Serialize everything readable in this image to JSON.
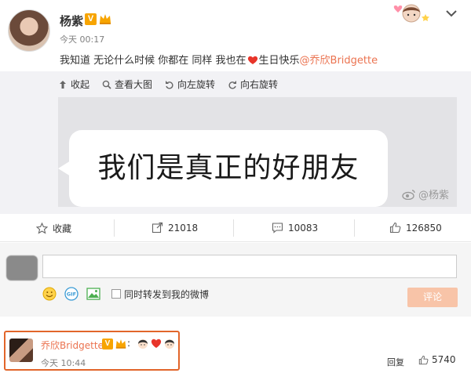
{
  "post": {
    "author": "杨紫",
    "verified_badge": "V",
    "time": "今天 00:17",
    "text_main": "我知道 无论什么时候 你都在 同样 我也在",
    "text_after_heart": "生日快乐",
    "mention": "@乔欣Bridgette"
  },
  "media": {
    "tools": [
      "收起",
      "查看大图",
      "向左旋转",
      "向右旋转"
    ],
    "image_text": "我们是真正的好朋友",
    "watermark": "@杨紫"
  },
  "actions": {
    "favorite": "收藏",
    "repost_count": "21018",
    "comment_count": "10083",
    "like_count": "126850"
  },
  "composer": {
    "sync_repost_label": "同时转发到我的微博",
    "submit_label": "评论"
  },
  "comment": {
    "author": "乔欣Bridgette",
    "verified_badge": "V",
    "colon": ":",
    "time": "今天 10:44",
    "report_label": "回复",
    "like_count": "5740"
  },
  "colors": {
    "accent_orange": "#eb7350",
    "highlight_border": "#e2652a",
    "submit_disabled": "#f8c4a8",
    "verified_gold": "#f7a400"
  },
  "icons": [
    "crown-icon",
    "heart-icon",
    "chevron-down-icon",
    "collapse-icon",
    "zoom-icon",
    "rotate-left-icon",
    "rotate-right-icon",
    "star-icon",
    "repost-icon",
    "comment-icon",
    "thumbs-up-icon",
    "smiley-icon",
    "gif-icon",
    "image-icon"
  ]
}
